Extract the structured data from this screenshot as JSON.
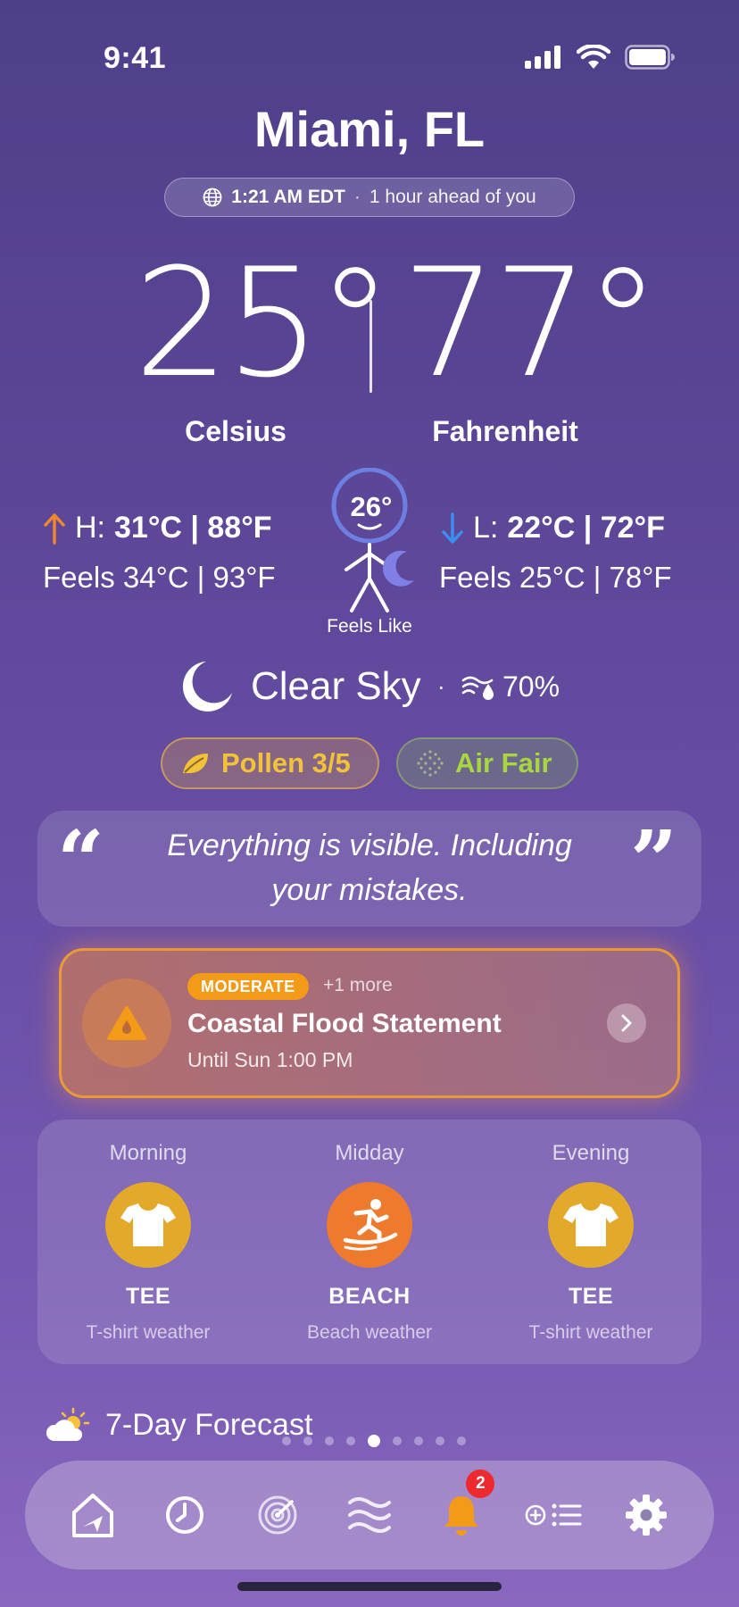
{
  "status_bar": {
    "time": "9:41"
  },
  "header": {
    "city": "Miami, FL",
    "local_time": "1:21 AM EDT",
    "separator": "·",
    "offset_text": "1 hour ahead of you"
  },
  "temps": {
    "celsius": "25°",
    "fahrenheit": "77°",
    "celsius_label": "Celsius",
    "fahrenheit_label": "Fahrenheit"
  },
  "high": {
    "prefix": "H:",
    "value": "31°C | 88°F",
    "feels": "Feels 34°C | 93°F"
  },
  "low": {
    "prefix": "L:",
    "value": "22°C | 72°F",
    "feels": "Feels 25°C | 78°F"
  },
  "feels_like": {
    "value": "26°",
    "caption": "Feels Like"
  },
  "condition": {
    "text": "Clear Sky",
    "separator": "·",
    "humidity": "70%"
  },
  "pills": {
    "pollen": "Pollen 3/5",
    "air": "Air Fair"
  },
  "quote": {
    "open": "“",
    "close": "”",
    "text": "Everything is visible. Including your mistakes."
  },
  "alert": {
    "severity": "MODERATE",
    "more": "+1 more",
    "title": "Coastal Flood Statement",
    "until": "Until Sun 1:00 PM"
  },
  "outfits": [
    {
      "period": "Morning",
      "name": "TEE",
      "desc": "T-shirt weather",
      "icon": "tshirt-icon"
    },
    {
      "period": "Midday",
      "name": "BEACH",
      "desc": "Beach weather",
      "icon": "surfer-icon"
    },
    {
      "period": "Evening",
      "name": "TEE",
      "desc": "T-shirt weather",
      "icon": "tshirt-icon"
    }
  ],
  "forecast": {
    "title": "7-Day Forecast"
  },
  "tabbar": {
    "notification_count": "2",
    "active_page": 4,
    "page_count": 9
  },
  "colors": {
    "accent_orange": "#f39a18",
    "pollen": "#f2c23a",
    "air": "#a9d63f",
    "high_arrow": "#f0882e",
    "low_arrow": "#3a8ff0"
  }
}
